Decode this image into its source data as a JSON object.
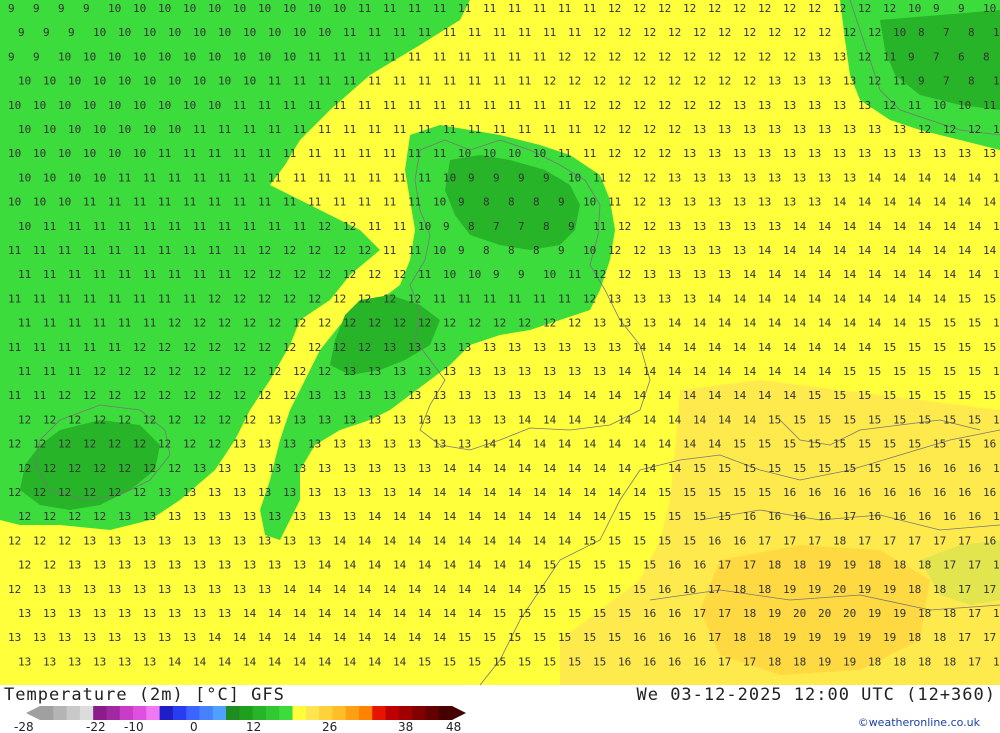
{
  "header": {
    "title": "Temperature (2m) [°C] GFS",
    "datetime": "We 03-12-2025 12:00 UTC (12+360)",
    "credit": "©weatheronline.co.uk"
  },
  "legend": {
    "ticks": [
      "-28",
      "-22",
      "-10",
      "0",
      "12",
      "26",
      "38",
      "48"
    ],
    "colors": [
      "#a0a0a0",
      "#b4b4b4",
      "#c8c8c8",
      "#dcdcdc",
      "#8c1c8c",
      "#a028a0",
      "#c83cc8",
      "#e050e0",
      "#f078f0",
      "#1e1ec8",
      "#283cf0",
      "#3c64ff",
      "#4682ff",
      "#50a0ff",
      "#1e8c1e",
      "#1ea01e",
      "#28b428",
      "#32c832",
      "#3cdc3c",
      "#ffff3c",
      "#ffe650",
      "#ffd23c",
      "#ffbe28",
      "#ffa014",
      "#ff8200",
      "#e61400",
      "#be0000",
      "#a00000",
      "#820000",
      "#640000",
      "#460000"
    ]
  },
  "map_colors": {
    "green_dark": "#1ea01e",
    "green_mid": "#28b428",
    "green_light": "#3cdc3c",
    "yellow": "#ffff3c",
    "yellow_orange": "#ffe650",
    "orange_light": "#ffd23c"
  }
}
